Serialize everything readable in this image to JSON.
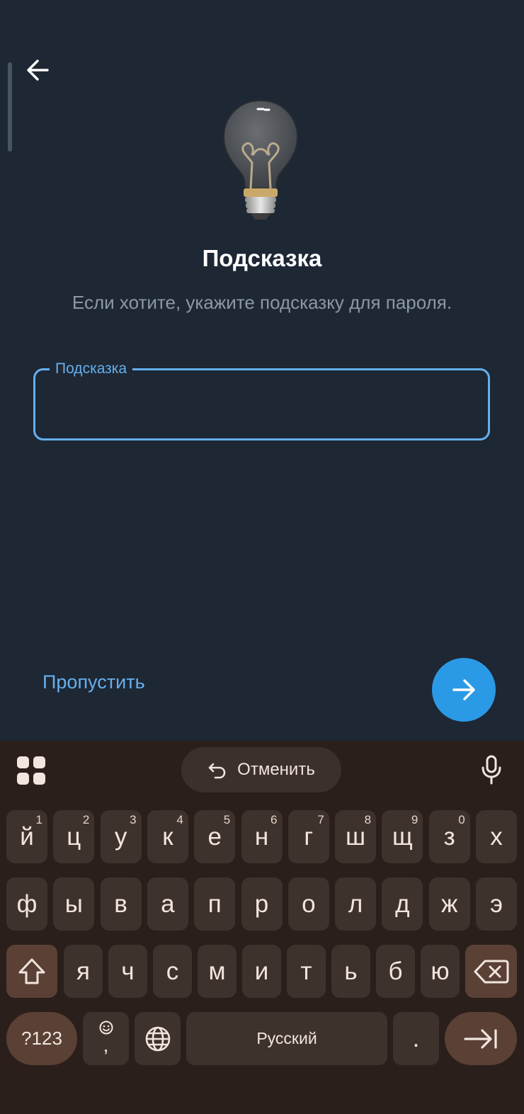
{
  "header": {
    "back_icon": "arrow-left-icon"
  },
  "hero": {
    "icon": "lightbulb-icon"
  },
  "title": "Подсказка",
  "subtitle": "Если хотите, укажите подсказку для пароля.",
  "hint_field": {
    "label": "Подсказка",
    "value": "",
    "placeholder": ""
  },
  "footer": {
    "skip_label": "Пропустить",
    "next_icon": "arrow-right-icon"
  },
  "colors": {
    "accent": "#64b0ee",
    "fab": "#2b9ae6",
    "background": "#1e2734",
    "keyboard_bg": "#2a1f1b",
    "key_bg": "#3e322c",
    "mod_key_bg": "#5a4035"
  },
  "keyboard": {
    "undo_label": "Отменить",
    "row1": [
      "й",
      "ц",
      "у",
      "к",
      "е",
      "н",
      "г",
      "ш",
      "щ",
      "з",
      "х"
    ],
    "row1_hints": [
      "1",
      "2",
      "3",
      "4",
      "5",
      "6",
      "7",
      "8",
      "9",
      "0",
      ""
    ],
    "row2": [
      "ф",
      "ы",
      "в",
      "а",
      "п",
      "р",
      "о",
      "л",
      "д",
      "ж",
      "э"
    ],
    "row3": [
      "я",
      "ч",
      "с",
      "м",
      "и",
      "т",
      "ь",
      "б",
      "ю"
    ],
    "symbols_label": "?123",
    "comma_label": ",",
    "space_label": "Русский",
    "period_label": "."
  }
}
